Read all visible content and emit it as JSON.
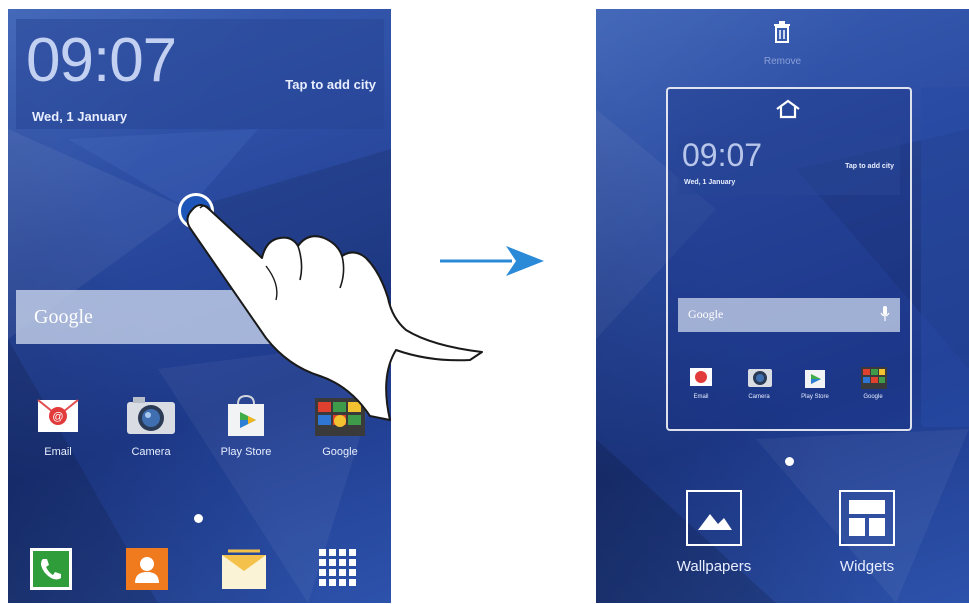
{
  "left_phone": {
    "clock": {
      "time": "09:07",
      "date": "Wed, 1 January",
      "city_prompt": "Tap to add city"
    },
    "search": {
      "label": "Google"
    },
    "apps": [
      {
        "label": "Email",
        "icon": "email-icon"
      },
      {
        "label": "Camera",
        "icon": "camera-icon"
      },
      {
        "label": "Play Store",
        "icon": "play-store-icon"
      },
      {
        "label": "Google",
        "icon": "google-folder-icon"
      }
    ],
    "dock": [
      {
        "icon": "phone-icon"
      },
      {
        "icon": "contacts-icon"
      },
      {
        "icon": "messages-icon"
      },
      {
        "icon": "apps-grid-icon"
      }
    ]
  },
  "gesture": {
    "type": "tap-and-hold",
    "icon": "hand-pointer-icon"
  },
  "transition": {
    "icon": "arrow-right-icon",
    "color": "#2a8ad8"
  },
  "right_phone": {
    "remove_label": "Remove",
    "preview": {
      "clock": {
        "time": "09:07",
        "date": "Wed, 1 January",
        "city_prompt": "Tap to add city"
      },
      "search": {
        "label": "Google"
      },
      "apps": [
        {
          "label": "Email"
        },
        {
          "label": "Camera"
        },
        {
          "label": "Play Store"
        },
        {
          "label": "Google"
        }
      ]
    },
    "options": [
      {
        "label": "Wallpapers",
        "icon": "wallpapers-icon"
      },
      {
        "label": "Widgets",
        "icon": "widgets-icon"
      }
    ]
  },
  "colors": {
    "screen_bg": "#2a4aa0",
    "accent": "#2a8ad8",
    "dock_phone": "#2e9d3a",
    "dock_contacts": "#f07a1e",
    "dock_messages": "#f4c24a"
  }
}
